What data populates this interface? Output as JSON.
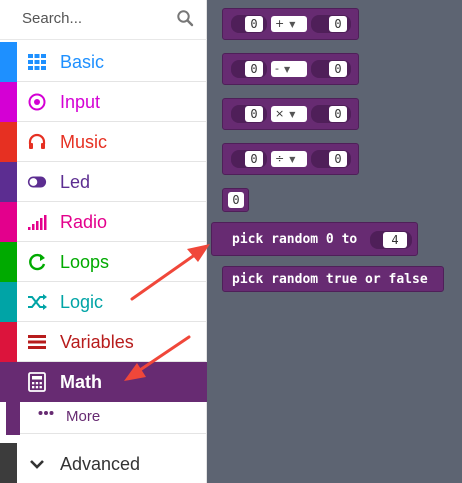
{
  "search": {
    "placeholder": "Search..."
  },
  "categories": [
    {
      "label": "Basic",
      "color": "#1e90ff",
      "icon": "grid-icon"
    },
    {
      "label": "Input",
      "color": "#d400d4",
      "icon": "target-icon"
    },
    {
      "label": "Music",
      "color": "#e63022",
      "icon": "headphones-icon"
    },
    {
      "label": "Led",
      "color": "#5c2d91",
      "icon": "toggle-icon"
    },
    {
      "label": "Radio",
      "color": "#e3008c",
      "icon": "signal-icon"
    },
    {
      "label": "Loops",
      "color": "#00aa00",
      "icon": "refresh-icon"
    },
    {
      "label": "Logic",
      "color": "#00a4a6",
      "icon": "shuffle-icon"
    },
    {
      "label": "Variables",
      "color": "#dc143c",
      "icon": "list-icon"
    },
    {
      "label": "Math",
      "color": "#9400d3",
      "icon": "calculator-icon",
      "selected": true
    }
  ],
  "more": {
    "label": "More"
  },
  "advanced": {
    "label": "Advanced"
  },
  "flyout": {
    "background": "#5d6472",
    "block_color": "#672b72",
    "blocks": [
      {
        "kind": "arith",
        "left": "0",
        "op": "+",
        "right": "0"
      },
      {
        "kind": "arith",
        "left": "0",
        "op": "-",
        "right": "0"
      },
      {
        "kind": "arith",
        "left": "0",
        "op": "×",
        "right": "0"
      },
      {
        "kind": "arith",
        "left": "0",
        "op": "÷",
        "right": "0"
      },
      {
        "kind": "number",
        "value": "0"
      },
      {
        "kind": "random",
        "text": "pick random 0 to",
        "value": "4"
      },
      {
        "kind": "random_bool",
        "text": "pick random true or false"
      }
    ]
  },
  "annotations": {
    "arrow_color": "#f0473a"
  }
}
